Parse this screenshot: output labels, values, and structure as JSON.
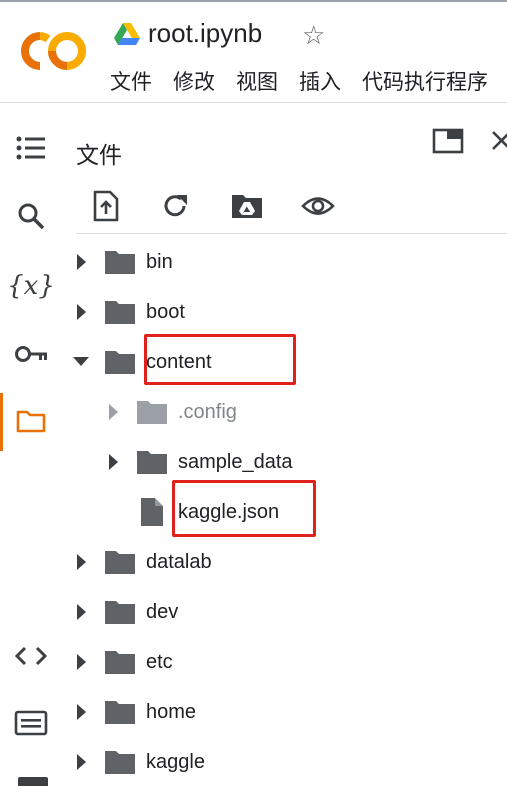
{
  "app": {
    "notebook_title": "root.ipynb",
    "logo_text": "CO",
    "menu": [
      "文件",
      "修改",
      "视图",
      "插入",
      "代码执行程序"
    ]
  },
  "rail": {
    "items": [
      {
        "name": "toc-icon"
      },
      {
        "name": "search-icon"
      },
      {
        "name": "variables-icon",
        "glyph": "{x}"
      },
      {
        "name": "secrets-key-icon"
      },
      {
        "name": "files-folder-icon",
        "active": true
      },
      {
        "name": "code-snippets-icon"
      },
      {
        "name": "terminal-icon"
      }
    ]
  },
  "files_panel": {
    "title": "文件",
    "toolbar": [
      "upload-file-icon",
      "refresh-icon",
      "mount-drive-icon",
      "show-hidden-files-icon"
    ],
    "tree": [
      {
        "label": "bin",
        "type": "folder",
        "expanded": false
      },
      {
        "label": "boot",
        "type": "folder",
        "expanded": false
      },
      {
        "label": "content",
        "type": "folder",
        "expanded": true,
        "highlighted": true
      },
      {
        "label": ".config",
        "type": "folder",
        "expanded": false,
        "hidden": true
      },
      {
        "label": "sample_data",
        "type": "folder",
        "expanded": false
      },
      {
        "label": "kaggle.json",
        "type": "file",
        "highlighted": true
      },
      {
        "label": "datalab",
        "type": "folder",
        "expanded": false
      },
      {
        "label": "dev",
        "type": "folder",
        "expanded": false
      },
      {
        "label": "etc",
        "type": "folder",
        "expanded": false
      },
      {
        "label": "home",
        "type": "folder",
        "expanded": false
      },
      {
        "label": "kaggle",
        "type": "folder",
        "expanded": false
      }
    ]
  },
  "colors": {
    "accent": "#e8710a",
    "logo_orange": "#f9ab00",
    "logo_dark": "#e8710a",
    "folder": "#5f6368",
    "highlight": "#e0201a"
  }
}
